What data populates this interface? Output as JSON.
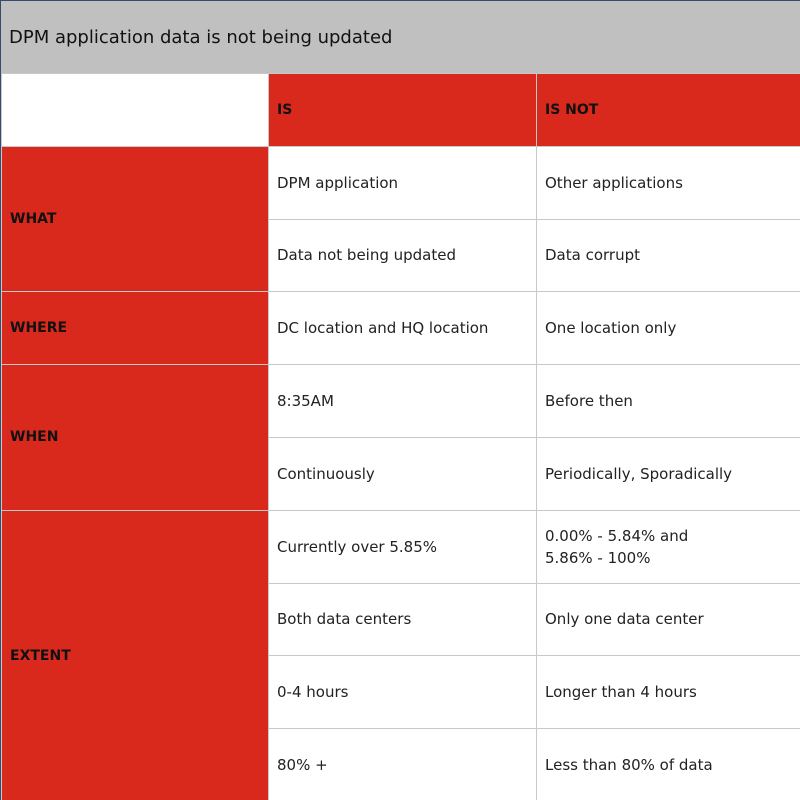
{
  "title": "DPM application data is not being updated",
  "headers": {
    "blank": "",
    "is": "IS",
    "is_not": "IS NOT"
  },
  "rows": {
    "what": {
      "label": "WHAT",
      "items": [
        {
          "is": "DPM application",
          "is_not": "Other applications"
        },
        {
          "is": "Data not being updated",
          "is_not": "Data corrupt"
        }
      ]
    },
    "where": {
      "label": "WHERE",
      "items": [
        {
          "is": "DC location and HQ location",
          "is_not": "One location only"
        }
      ]
    },
    "when": {
      "label": "WHEN",
      "items": [
        {
          "is": "8:35AM",
          "is_not": "Before then"
        },
        {
          "is": "Continuously",
          "is_not": "Periodically, Sporadically"
        }
      ]
    },
    "extent": {
      "label": "EXTENT",
      "items": [
        {
          "is": "Currently over 5.85%",
          "is_not_line1": "0.00% - 5.84% and",
          "is_not_line2": "5.86% - 100%"
        },
        {
          "is": "Both data centers",
          "is_not": "Only one data center"
        },
        {
          "is": "0-4 hours",
          "is_not": "Longer than 4 hours"
        },
        {
          "is": "80% +",
          "is_not": "Less than 80% of data"
        }
      ]
    }
  },
  "colors": {
    "accent_red": "#d9291c",
    "title_bg": "#c0c0c0"
  }
}
